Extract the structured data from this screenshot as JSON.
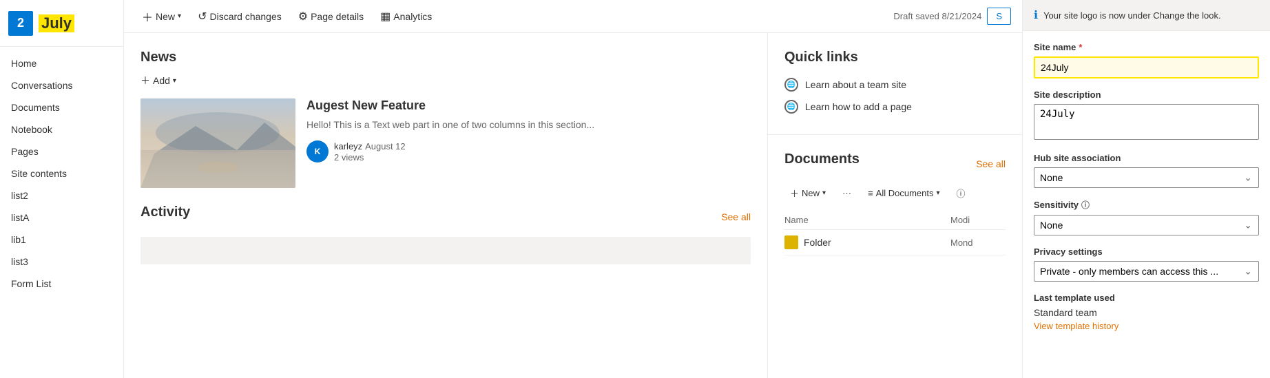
{
  "sidebar": {
    "logo": {
      "number": "2",
      "text": "July"
    },
    "items": [
      {
        "label": "Home",
        "id": "home"
      },
      {
        "label": "Conversations",
        "id": "conversations"
      },
      {
        "label": "Documents",
        "id": "documents"
      },
      {
        "label": "Notebook",
        "id": "notebook"
      },
      {
        "label": "Pages",
        "id": "pages"
      },
      {
        "label": "Site contents",
        "id": "site-contents"
      },
      {
        "label": "list2",
        "id": "list2"
      },
      {
        "label": "listA",
        "id": "lista"
      },
      {
        "label": "lib1",
        "id": "lib1"
      },
      {
        "label": "list3",
        "id": "list3"
      },
      {
        "label": "Form List",
        "id": "form-list"
      }
    ]
  },
  "toolbar": {
    "new_label": "New",
    "discard_label": "Discard changes",
    "page_details_label": "Page details",
    "analytics_label": "Analytics",
    "draft_saved": "Draft saved 8/21/2024",
    "share_label": "S"
  },
  "news": {
    "title": "News",
    "add_label": "Add",
    "article": {
      "title": "Augest New Feature",
      "excerpt": "Hello! This is a Text web part in one of two columns in this section...",
      "author": "karleyz",
      "date": "August 12",
      "views": "2 views"
    }
  },
  "activity": {
    "title": "Activity",
    "see_all_label": "See all"
  },
  "quick_links": {
    "title": "Quick links",
    "items": [
      {
        "label": "Learn about a team site",
        "id": "learn-team"
      },
      {
        "label": "Learn how to add a page",
        "id": "learn-page"
      }
    ]
  },
  "documents": {
    "title": "Documents",
    "see_all_label": "See all",
    "new_label": "New",
    "all_documents_label": "All Documents",
    "columns": {
      "name": "Name",
      "modified": "Modi"
    },
    "rows": [
      {
        "name": "Folder",
        "modified": "Mond",
        "type": "folder"
      }
    ]
  },
  "settings_panel": {
    "notification": "Your site logo is now under Change the look.",
    "site_name_label": "Site name",
    "site_name_value": "24July",
    "site_description_label": "Site description",
    "site_description_value": "24July",
    "hub_site_label": "Hub site association",
    "hub_site_value": "None",
    "sensitivity_label": "Sensitivity",
    "sensitivity_value": "None",
    "privacy_label": "Privacy settings",
    "privacy_value": "Private - only members can access this ...",
    "privacy_full": "Private only members can access this",
    "last_template_label": "Last template used",
    "template_name": "Standard team",
    "view_history_label": "View template history"
  }
}
